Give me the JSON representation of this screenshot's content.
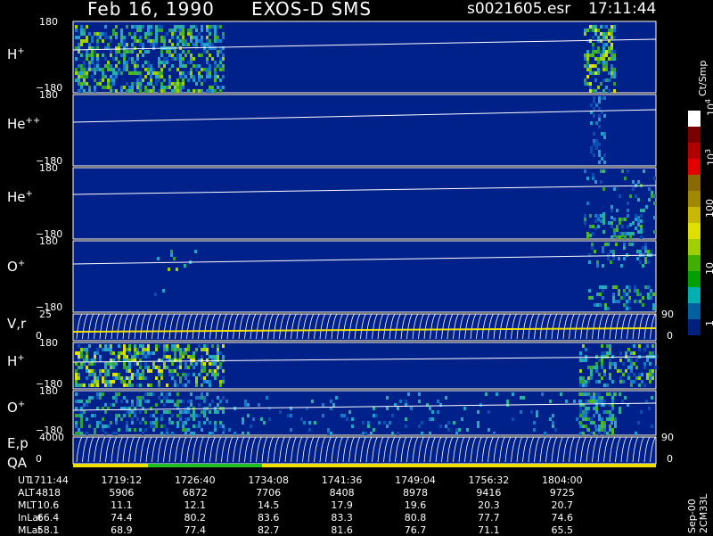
{
  "header": {
    "date": "Feb 16, 1990",
    "mission": "EXOS-D SMS",
    "file": "s0021605.esr",
    "time": "17:11:44"
  },
  "colorbar": {
    "unit_label": "Ct/Smp",
    "ticks": [
      {
        "label": "10",
        "sup": "4"
      },
      {
        "label": "10",
        "sup": "3"
      },
      {
        "label": "100",
        "sup": ""
      },
      {
        "label": "10",
        "sup": ""
      },
      {
        "label": "1",
        "sup": ""
      }
    ],
    "colors": [
      "#ffffff",
      "#7a0000",
      "#b00000",
      "#e00000",
      "#8a6a00",
      "#a08800",
      "#c8b800",
      "#e0e000",
      "#a0d000",
      "#40b000",
      "#00a000",
      "#00b0b0",
      "#0060a0",
      "#002080"
    ]
  },
  "colors": {
    "background": "#000000",
    "panel_bg": "#00208a",
    "trace": "#ffffff",
    "qa_bar": "#f0e000",
    "qa_highlight": "#20c020"
  },
  "chart_data": {
    "type": "heatmap",
    "panels": [
      {
        "id": "h_plus",
        "species": "H",
        "charge": "+",
        "ymax": "180",
        "ymin": "−180",
        "ylim": [
          -180,
          180
        ]
      },
      {
        "id": "he_pp",
        "species": "He",
        "charge": "++",
        "ymax": "180",
        "ymin": "−180",
        "ylim": [
          -180,
          180
        ]
      },
      {
        "id": "he_plus",
        "species": "He",
        "charge": "+",
        "ymax": "180",
        "ymin": "−180",
        "ylim": [
          -180,
          180
        ]
      },
      {
        "id": "o_plus",
        "species": "O",
        "charge": "+",
        "ymax": "180",
        "ymin": "−180",
        "ylim": [
          -180,
          180
        ]
      },
      {
        "id": "vr",
        "label": "V,r",
        "ymax": "25",
        "ymin": "0",
        "ymax_right": "90",
        "ymin_right": "0",
        "ylim": [
          0,
          25
        ]
      },
      {
        "id": "h_plus_2",
        "species": "H",
        "charge": "+",
        "ymax": "180",
        "ymin": "−180",
        "ylim": [
          -180,
          180
        ]
      },
      {
        "id": "o_plus_2",
        "species": "O",
        "charge": "+",
        "ymax": "180",
        "ymin": "−180",
        "ylim": [
          -180,
          180
        ]
      },
      {
        "id": "ep",
        "label": "E,p",
        "ymax": "4000",
        "ymin": "0",
        "ymax_right": "90",
        "ymin_right": "0",
        "ylim": [
          0,
          4000
        ]
      }
    ],
    "qa_label": "QA",
    "time_axis": {
      "row_labels": [
        "UT",
        "ALT",
        "MLT",
        "InLat",
        "MLat"
      ],
      "columns": [
        {
          "UT": "1711:44",
          "ALT": "4818",
          "MLT": "10.6",
          "InLat": "66.4",
          "MLat": "58.1"
        },
        {
          "UT": "1719:12",
          "ALT": "5906",
          "MLT": "11.1",
          "InLat": "74.4",
          "MLat": "68.9"
        },
        {
          "UT": "1726:40",
          "ALT": "6872",
          "MLT": "12.1",
          "InLat": "80.2",
          "MLat": "77.4"
        },
        {
          "UT": "1734:08",
          "ALT": "7706",
          "MLT": "14.5",
          "InLat": "83.6",
          "MLat": "82.7"
        },
        {
          "UT": "1741:36",
          "ALT": "8408",
          "MLT": "17.9",
          "InLat": "83.3",
          "MLat": "81.6"
        },
        {
          "UT": "1749:04",
          "ALT": "8978",
          "MLT": "19.6",
          "InLat": "80.8",
          "MLat": "76.7"
        },
        {
          "UT": "1756:32",
          "ALT": "9416",
          "MLT": "20.3",
          "InLat": "77.7",
          "MLat": "71.1"
        },
        {
          "UT": "1804:00",
          "ALT": "9725",
          "MLT": "20.7",
          "InLat": "74.6",
          "MLat": "65.5"
        }
      ]
    }
  },
  "footer": {
    "id": "Sep-00 2CM33L"
  }
}
